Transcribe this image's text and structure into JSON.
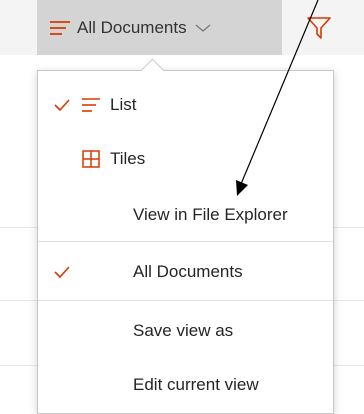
{
  "toolbar": {
    "view_selector_label": "All Documents"
  },
  "menu": {
    "items": [
      {
        "label": "List",
        "checked": true,
        "icon": "list-icon"
      },
      {
        "label": "Tiles",
        "checked": false,
        "icon": "tiles-icon"
      },
      {
        "label": "View in File Explorer",
        "checked": false
      },
      {
        "label": "All Documents",
        "checked": true
      },
      {
        "label": "Save view as",
        "checked": false
      },
      {
        "label": "Edit current view",
        "checked": false
      }
    ]
  },
  "colors": {
    "accent": "#d83b01",
    "selector_bg": "#d4d4d4",
    "menu_border": "#c8c8c8",
    "text": "#252525"
  },
  "icons": [
    "list-icon",
    "chevron-down-icon",
    "filter-icon",
    "checkmark-icon",
    "tiles-icon",
    "annotation-arrow"
  ]
}
